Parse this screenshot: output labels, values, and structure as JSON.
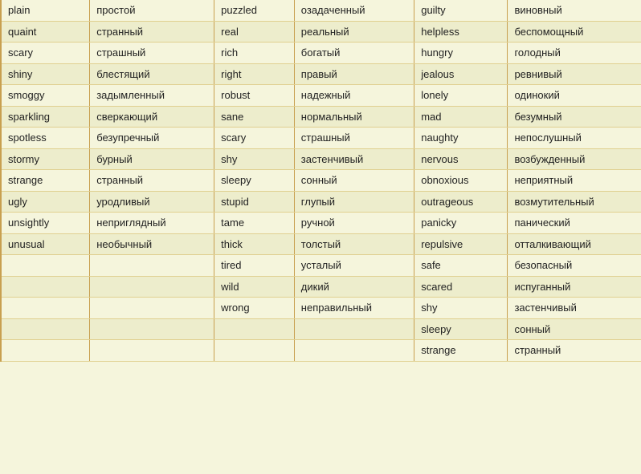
{
  "columns": [
    {
      "id": "col1",
      "pairs": [
        [
          "plain",
          "простой"
        ],
        [
          "quaint",
          "странный"
        ],
        [
          "scary",
          "страшный"
        ],
        [
          "shiny",
          "блестящий"
        ],
        [
          "smoggy",
          "задымленный"
        ],
        [
          "sparkling",
          "сверкающий"
        ],
        [
          "spotless",
          "безупречный"
        ],
        [
          "stormy",
          "бурный"
        ],
        [
          "strange",
          "странный"
        ],
        [
          "ugly",
          "уродливый"
        ],
        [
          "unsightly",
          "неприглядный"
        ],
        [
          "unusual",
          "необычный"
        ]
      ]
    },
    {
      "id": "col2",
      "pairs": [
        [
          "puzzled",
          "озадаченный"
        ],
        [
          "real",
          "реальный"
        ],
        [
          "rich",
          "богатый"
        ],
        [
          "right",
          "правый"
        ],
        [
          "robust",
          "надежный"
        ],
        [
          "sane",
          "нормальный"
        ],
        [
          "scary",
          "страшный"
        ],
        [
          "shy",
          "застенчивый"
        ],
        [
          "sleepy",
          "сонный"
        ],
        [
          "stupid",
          "глупый"
        ],
        [
          "tame",
          "ручной"
        ],
        [
          "thick",
          "толстый"
        ],
        [
          "tired",
          "усталый"
        ],
        [
          "wild",
          "дикий"
        ],
        [
          "wrong",
          "неправильный"
        ]
      ]
    },
    {
      "id": "col3",
      "pairs": [
        [
          "guilty",
          "виновный"
        ],
        [
          "helpless",
          "беспомощный"
        ],
        [
          "hungry",
          "голодный"
        ],
        [
          "jealous",
          "ревнивый"
        ],
        [
          "lonely",
          "одинокий"
        ],
        [
          "mad",
          "безумный"
        ],
        [
          "naughty",
          "непослушный"
        ],
        [
          "nervous",
          "возбужденный"
        ],
        [
          "obnoxious",
          "неприятный"
        ],
        [
          "outrageous",
          "возмутительный"
        ],
        [
          "panicky",
          "панический"
        ],
        [
          "repulsive",
          "отталкивающий"
        ],
        [
          "safe",
          "безопасный"
        ],
        [
          "scared",
          "испуганный"
        ],
        [
          "shy",
          "застенчивый"
        ],
        [
          "sleepy",
          "сонный"
        ],
        [
          "strange",
          "странный"
        ]
      ]
    }
  ]
}
